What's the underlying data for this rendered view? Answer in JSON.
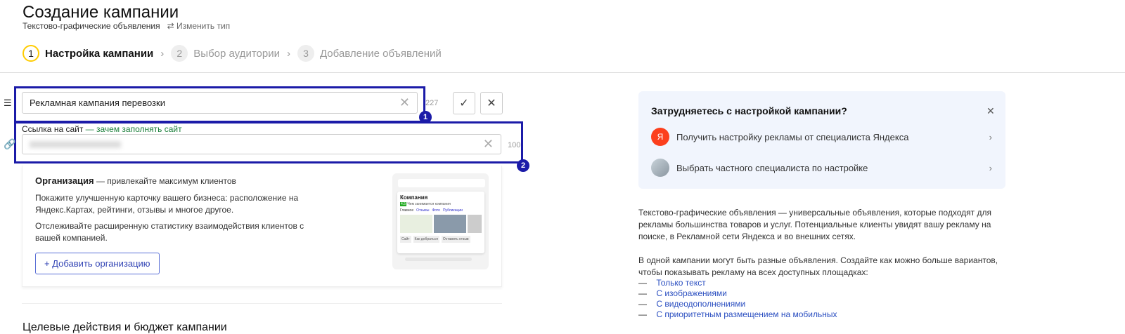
{
  "header": {
    "title": "Создание кампании",
    "subtitle": "Текстово-графические объявления",
    "change_type": "Изменить тип"
  },
  "steps": [
    {
      "num": "1",
      "label": "Настройка кампании"
    },
    {
      "num": "2",
      "label": "Выбор аудитории"
    },
    {
      "num": "3",
      "label": "Добавление объявлений"
    }
  ],
  "form": {
    "name_value": "Рекламная кампания перевозки",
    "name_counter": "227",
    "site_label": "Ссылка на сайт",
    "site_hint": "— зачем заполнять сайт",
    "site_counter": "100",
    "badge1": "1",
    "badge2": "2"
  },
  "org": {
    "title": "Организация",
    "title_hint": " — привлекайте максимум клиентов",
    "p1": "Покажите улучшенную карточку вашего бизнеса: расположение на Яндекс.Картах, рейтинги, отзывы и многое другое.",
    "p2": "Отслеживайте расширенную статистику взаимодействия клиентов с вашей компанией.",
    "add_button": "Добавить организацию",
    "preview": {
      "company": "Компания",
      "rating": "4.5",
      "tagline": "Чем занимается компания",
      "tabs": [
        "Главное",
        "Отзывы",
        "Фото",
        "Публикации"
      ],
      "buttons": [
        "Сайт",
        "Как добраться",
        "Оставить отзыв"
      ]
    }
  },
  "help": {
    "title": "Затрудняетесь с настройкой кампании?",
    "items": [
      {
        "label": "Получить настройку рекламы от специалиста Яндекса",
        "avatar": "Я"
      },
      {
        "label": "Выбрать частного специалиста по настройке"
      }
    ]
  },
  "description": {
    "p1": "Текстово-графические объявления — универсальные объявления, которые подходят для рекламы большинства товаров и услуг. Потенциальные клиенты увидят вашу рекламу на поиске, в Рекламной сети Яндекса и во внешних сетях.",
    "p2": "В одной кампании могут быть разные объявления. Создайте как можно больше вариантов, чтобы показывать рекламу на всех доступных площадках:",
    "links": [
      "Только текст",
      "С изображениями",
      "С видеодополнениями",
      "С приоритетным размещением на мобильных"
    ]
  },
  "section_next": "Целевые действия и бюджет кампании",
  "colors": {
    "highlight": "#1b1ba8",
    "step_active": "#ffcc00",
    "link": "#2a4ec0",
    "hint_green": "#1a7f3a",
    "yandex_red": "#fc3f1d"
  }
}
